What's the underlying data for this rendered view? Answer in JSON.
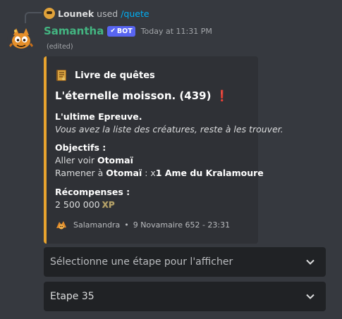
{
  "reply": {
    "user": "Lounek",
    "action": "used",
    "command": "/quete"
  },
  "message": {
    "username": "Samantha",
    "bot_badge": "BOT",
    "timestamp": "Today at 11:31 PM",
    "edited": "(edited)"
  },
  "embed": {
    "accent_color": "#e8a32e",
    "author_icon": "quest-book-icon",
    "author": "Livre de quêtes",
    "title": "L'éternelle moisson. (439)",
    "title_icon": "exclamation-icon",
    "description": {
      "heading": "L'ultime Epreuve.",
      "text": "Vous avez la liste des créatures, reste à les trouver."
    },
    "objectives": {
      "name": "Objectifs :",
      "line1_prefix": "Aller voir ",
      "line1_target": "Otomaï",
      "line2_prefix": "Ramener à ",
      "line2_target": "Otomaï",
      "line2_mid": " : x",
      "line2_item": "1 Ame du Kralamoure"
    },
    "rewards": {
      "name": "Récompenses :",
      "xp": "2 500 000",
      "xp_icon_text": "XP"
    },
    "footer": {
      "icon": "cat-pet-icon",
      "server": "Salamandra",
      "separator": "•",
      "date": "9 Novamaire 652 - 23:31"
    }
  },
  "components": {
    "select_step_placeholder": "Sélectionne une étape pour l'afficher",
    "current_step": "Etape 35"
  }
}
